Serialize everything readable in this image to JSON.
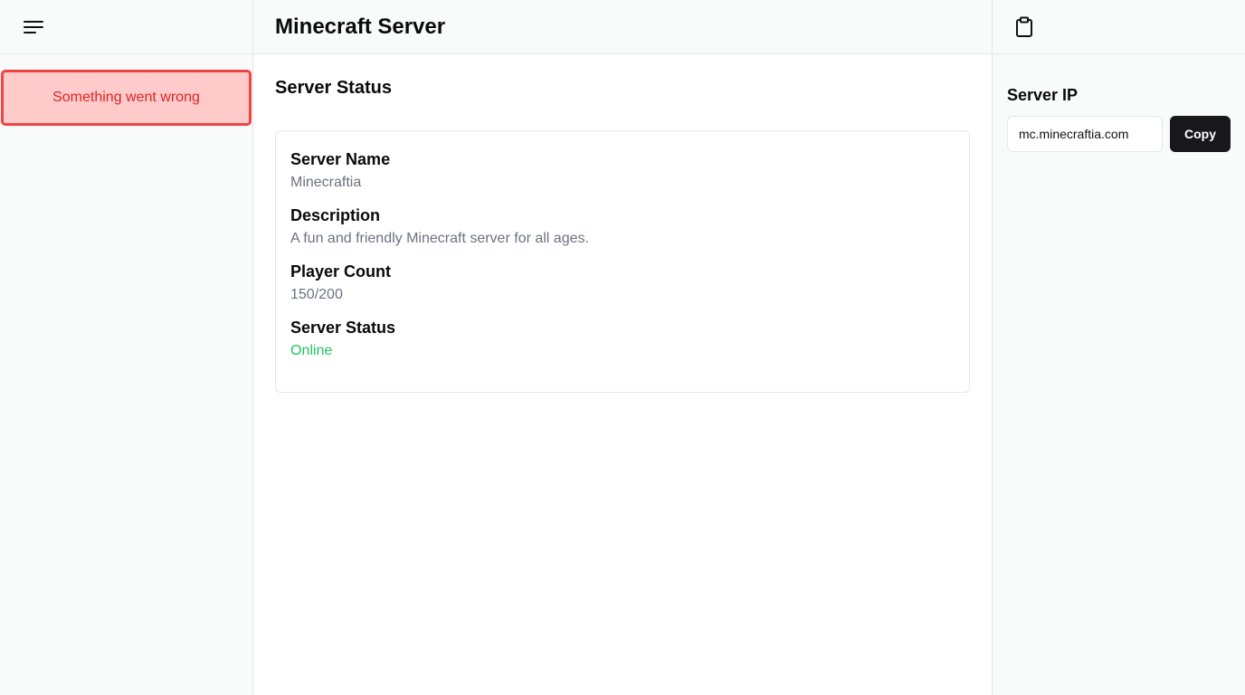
{
  "header": {
    "title": "Minecraft Server"
  },
  "sidebar": {
    "error_message": "Something went wrong"
  },
  "main": {
    "section_title": "Server Status",
    "fields": [
      {
        "label": "Server Name",
        "value": "Minecraftia"
      },
      {
        "label": "Description",
        "value": "A fun and friendly Minecraft server for all ages."
      },
      {
        "label": "Player Count",
        "value": "150/200"
      },
      {
        "label": "Server Status",
        "value": "Online"
      }
    ]
  },
  "rightpanel": {
    "ip_label": "Server IP",
    "ip_value": "mc.minecraftia.com",
    "copy_label": "Copy"
  },
  "icons": {
    "menu": "menu-icon",
    "clipboard": "clipboard-icon"
  },
  "colors": {
    "error_bg": "#fecaca",
    "error_border": "#ef4444",
    "error_text": "#dc2626",
    "online": "#22c55e",
    "button_bg": "#18181b"
  }
}
